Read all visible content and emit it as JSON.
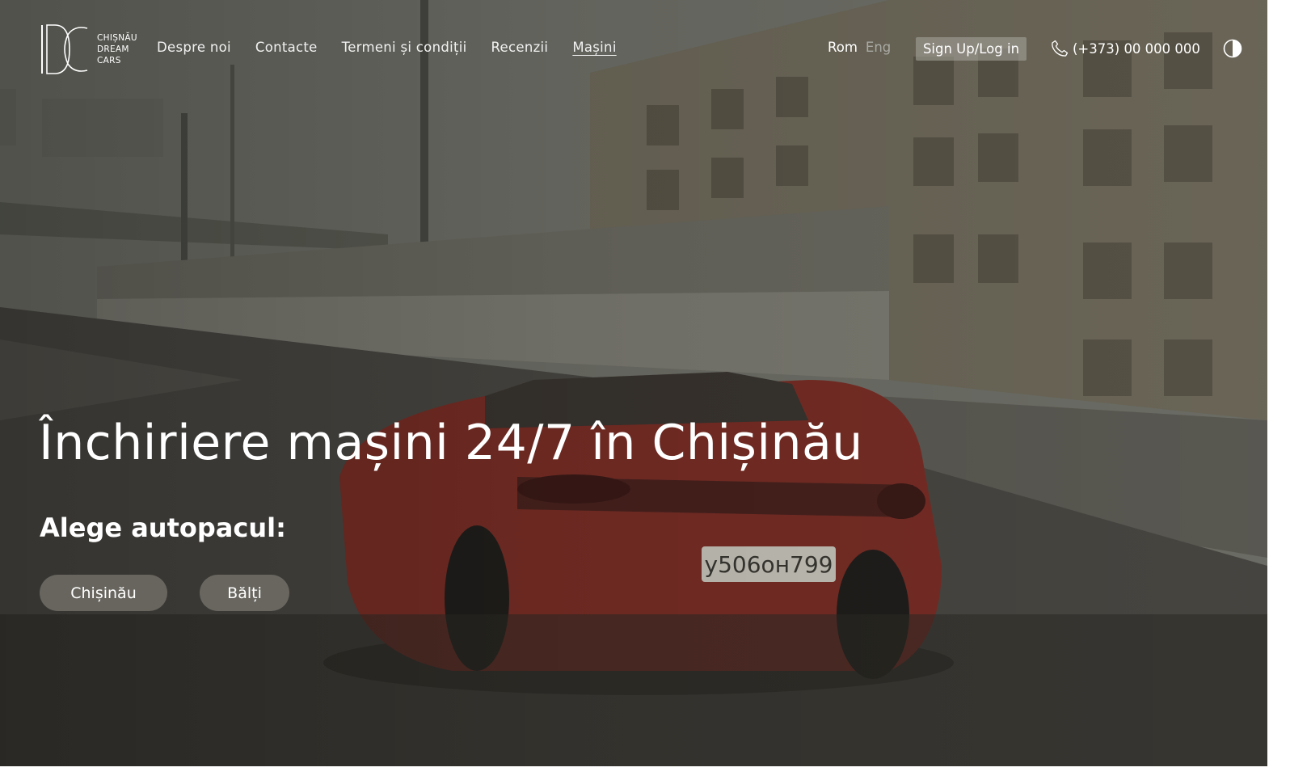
{
  "brand": {
    "logo_line1": "CHIȘNĂU",
    "logo_line2": "DREAM",
    "logo_line3": "CARS"
  },
  "nav": {
    "items": [
      {
        "label": "Despre noi",
        "active": false
      },
      {
        "label": "Contacte",
        "active": false
      },
      {
        "label": "Termeni și condiții",
        "active": false
      },
      {
        "label": "Recenzii",
        "active": false
      },
      {
        "label": "Mașini",
        "active": true
      }
    ]
  },
  "language": {
    "current": "Rom",
    "other": "Eng"
  },
  "auth": {
    "signup_label": "Sign Up/Log in"
  },
  "contact": {
    "phone": "(+373) 00 000 000",
    "icon": "phone-icon"
  },
  "theme": {
    "icon": "contrast-toggle-icon"
  },
  "hero": {
    "headline": "Închiriere mașini 24/7 în Chișinău",
    "subheading": "Alege autopacul:",
    "locations": [
      "Chișinău",
      "Bălți"
    ]
  },
  "colors": {
    "text": "#ffffff",
    "inactive_lang": "#a9a9a4",
    "button_bg": "#78766e"
  }
}
